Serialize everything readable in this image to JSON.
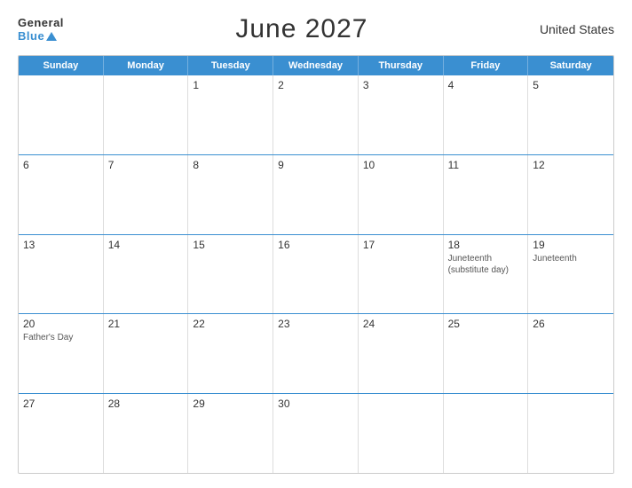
{
  "logo": {
    "general": "General",
    "blue": "Blue"
  },
  "title": "June 2027",
  "country": "United States",
  "header_days": [
    "Sunday",
    "Monday",
    "Tuesday",
    "Wednesday",
    "Thursday",
    "Friday",
    "Saturday"
  ],
  "weeks": [
    [
      {
        "day": "",
        "event": ""
      },
      {
        "day": "",
        "event": ""
      },
      {
        "day": "1",
        "event": ""
      },
      {
        "day": "2",
        "event": ""
      },
      {
        "day": "3",
        "event": ""
      },
      {
        "day": "4",
        "event": ""
      },
      {
        "day": "5",
        "event": ""
      }
    ],
    [
      {
        "day": "6",
        "event": ""
      },
      {
        "day": "7",
        "event": ""
      },
      {
        "day": "8",
        "event": ""
      },
      {
        "day": "9",
        "event": ""
      },
      {
        "day": "10",
        "event": ""
      },
      {
        "day": "11",
        "event": ""
      },
      {
        "day": "12",
        "event": ""
      }
    ],
    [
      {
        "day": "13",
        "event": ""
      },
      {
        "day": "14",
        "event": ""
      },
      {
        "day": "15",
        "event": ""
      },
      {
        "day": "16",
        "event": ""
      },
      {
        "day": "17",
        "event": ""
      },
      {
        "day": "18",
        "event": "Juneteenth\n(substitute day)"
      },
      {
        "day": "19",
        "event": "Juneteenth"
      }
    ],
    [
      {
        "day": "20",
        "event": "Father's Day"
      },
      {
        "day": "21",
        "event": ""
      },
      {
        "day": "22",
        "event": ""
      },
      {
        "day": "23",
        "event": ""
      },
      {
        "day": "24",
        "event": ""
      },
      {
        "day": "25",
        "event": ""
      },
      {
        "day": "26",
        "event": ""
      }
    ],
    [
      {
        "day": "27",
        "event": ""
      },
      {
        "day": "28",
        "event": ""
      },
      {
        "day": "29",
        "event": ""
      },
      {
        "day": "30",
        "event": ""
      },
      {
        "day": "",
        "event": ""
      },
      {
        "day": "",
        "event": ""
      },
      {
        "day": "",
        "event": ""
      }
    ]
  ]
}
